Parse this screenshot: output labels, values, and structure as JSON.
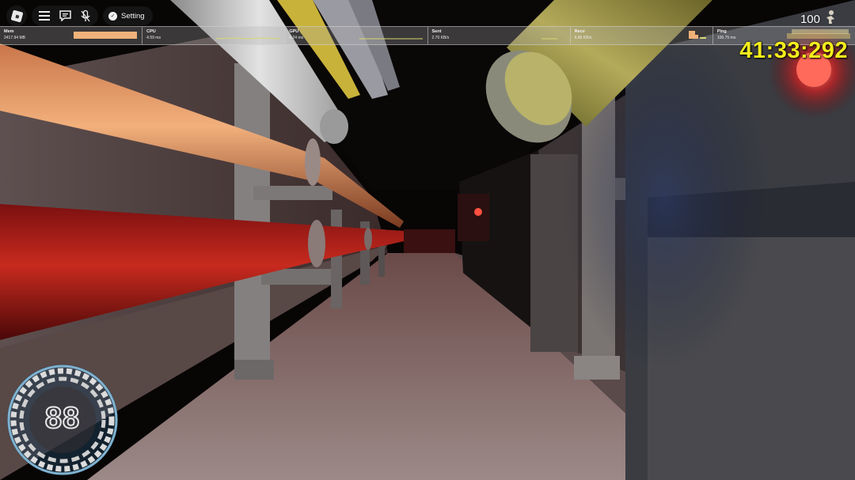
{
  "topbar": {
    "roblox_icon": "roblox-logo-icon",
    "menu_icon": "hamburger-menu-icon",
    "chat_icon": "chat-bubble-icon",
    "mic_icon": "microphone-muted-icon",
    "setting_label": "Setting"
  },
  "stats": [
    {
      "label": "Mem",
      "value": "2417.94 MB"
    },
    {
      "label": "CPU",
      "value": "4.59 ms"
    },
    {
      "label": "GPU",
      "value": "4.24 ms"
    },
    {
      "label": "Sent",
      "value": "2.70 KB/s"
    },
    {
      "label": "Recv",
      "value": "6.85 KB/s"
    },
    {
      "label": "Ping",
      "value": "106.75 ms"
    }
  ],
  "hud": {
    "health": "100",
    "timer": "41:33:292",
    "speed": "88",
    "timer_color": "#f4ec1c",
    "health_icon": "player-figure-icon"
  },
  "speedometer": {
    "icon": "speedometer-ring-icon"
  }
}
